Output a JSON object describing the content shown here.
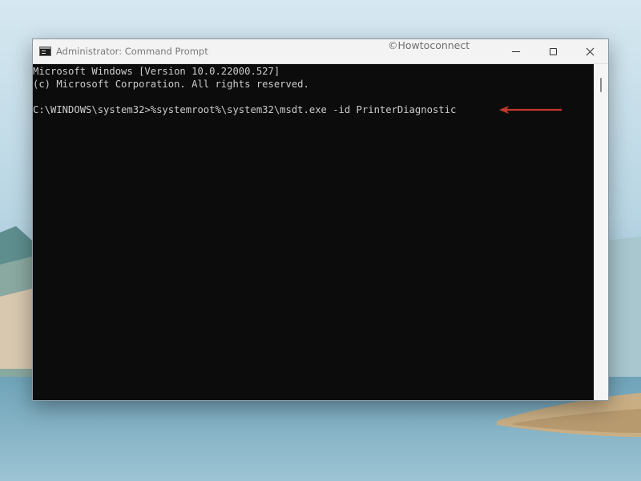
{
  "window": {
    "title": "Administrator: Command Prompt",
    "watermark": "©Howtoconnect"
  },
  "console": {
    "lines": [
      "Microsoft Windows [Version 10.0.22000.527]",
      "(c) Microsoft Corporation. All rights reserved.",
      "",
      "C:\\WINDOWS\\system32>%systemroot%\\system32\\msdt.exe -id PrinterDiagnostic"
    ]
  },
  "colors": {
    "console_bg": "#0c0c0c",
    "console_text": "#cccccc",
    "annotation_arrow": "#c0392b"
  },
  "icons": {
    "app": "command-prompt-icon",
    "minimize": "minimize-icon",
    "maximize": "maximize-icon",
    "close": "close-icon",
    "annotation": "arrow-left-icon"
  }
}
